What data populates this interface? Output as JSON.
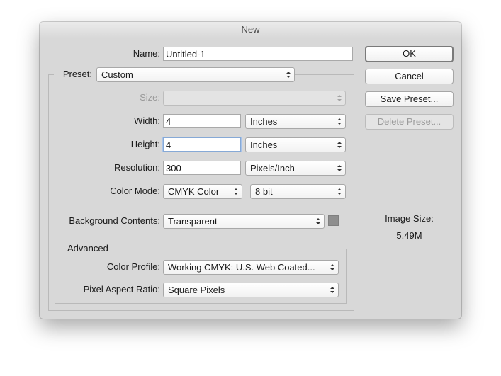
{
  "window": {
    "title": "New"
  },
  "form": {
    "name_label": "Name:",
    "name_value": "Untitled-1",
    "preset_label": "Preset:",
    "preset_value": "Custom",
    "size_label": "Size:",
    "size_value": "",
    "width_label": "Width:",
    "width_value": "4",
    "width_unit": "Inches",
    "height_label": "Height:",
    "height_value": "4",
    "height_unit": "Inches",
    "resolution_label": "Resolution:",
    "resolution_value": "300",
    "resolution_unit": "Pixels/Inch",
    "color_mode_label": "Color Mode:",
    "color_mode_value": "CMYK Color",
    "bit_depth_value": "8 bit",
    "background_label": "Background Contents:",
    "background_value": "Transparent",
    "background_swatch_color": "#8e8e8e"
  },
  "advanced": {
    "legend": "Advanced",
    "color_profile_label": "Color Profile:",
    "color_profile_value": "Working CMYK:  U.S. Web Coated...",
    "pixel_aspect_label": "Pixel Aspect Ratio:",
    "pixel_aspect_value": "Square Pixels"
  },
  "buttons": {
    "ok": "OK",
    "cancel": "Cancel",
    "save_preset": "Save Preset...",
    "delete_preset": "Delete Preset..."
  },
  "image_size": {
    "label": "Image Size:",
    "value": "5.49M"
  }
}
